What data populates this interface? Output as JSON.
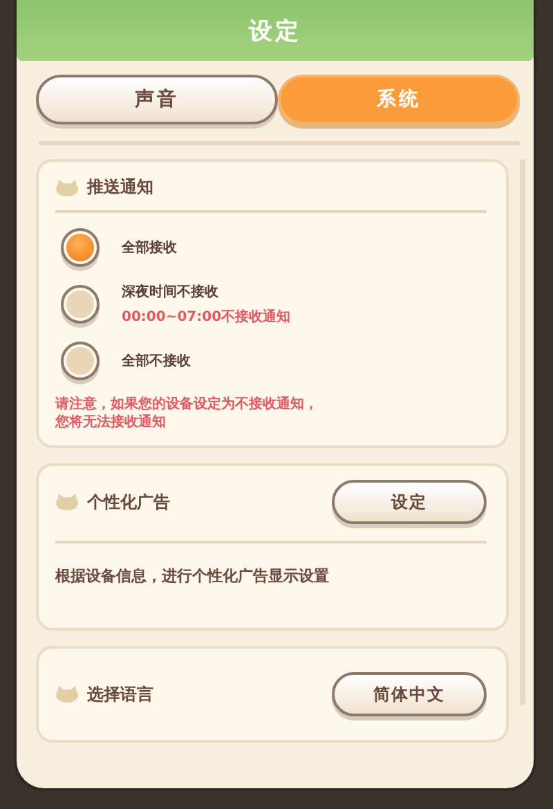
{
  "window": {
    "title": "设定"
  },
  "tabs": [
    {
      "label": "声音",
      "selected": false
    },
    {
      "label": "系统",
      "selected": true
    }
  ],
  "push": {
    "title": "推送通知",
    "options": [
      {
        "label": "全部接收",
        "selected": true
      },
      {
        "label": "深夜时间不接收",
        "note": "00:00~07:00不接收通知",
        "selected": false
      },
      {
        "label": "全部不接收",
        "selected": false
      }
    ],
    "warning": [
      "请注意，如果您的设备设定为不接收通知，",
      "您将无法接收通知"
    ]
  },
  "ads": {
    "title": "个性化广告",
    "button": "设定",
    "description": "根据设备信息，进行个性化广告显示设置"
  },
  "language": {
    "title": "选择语言",
    "button": "简体中文"
  }
}
